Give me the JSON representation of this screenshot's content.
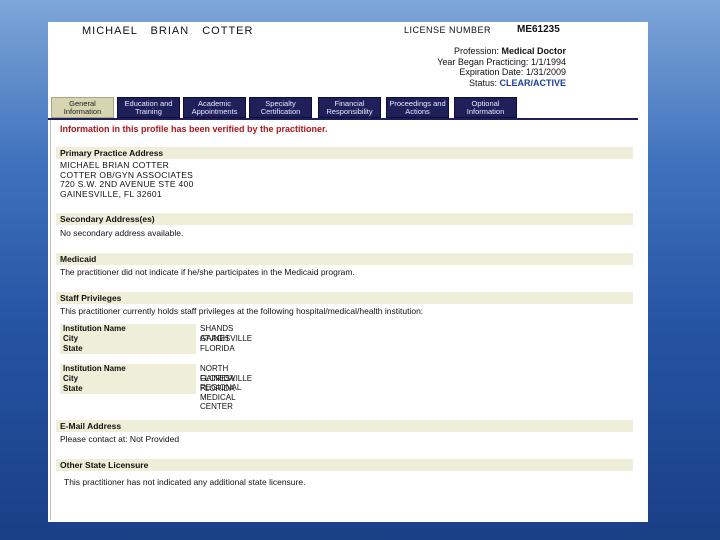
{
  "header": {
    "name": "MICHAEL BRIAN COTTER",
    "license_label": "LICENSE NUMBER",
    "license_number": "ME61235",
    "fields": [
      {
        "label": "Profession:",
        "value": "Medical Doctor"
      },
      {
        "label": "Year Began Practicing:",
        "value": "1/1/1994"
      },
      {
        "label": "Expiration Date:",
        "value": "1/31/2009"
      },
      {
        "label": "Status:",
        "value": "CLEAR/ACTIVE"
      }
    ]
  },
  "tabs": [
    {
      "label": "General Information"
    },
    {
      "label": "Education and Training"
    },
    {
      "label": "Academic Appointments"
    },
    {
      "label": "Specialty Certification"
    },
    {
      "label": "Financial Responsibility"
    },
    {
      "label": "Proceedings and Actions"
    },
    {
      "label": "Optional Information"
    }
  ],
  "verified_notice": "Information in this profile has been verified by the practitioner.",
  "primary_address": {
    "title": "Primary Practice Address",
    "lines": [
      "MICHAEL BRIAN COTTER",
      "COTTER OB/GYN ASSOCIATES",
      "720 S.W. 2ND AVENUE STE 400",
      "GAINESVILLE, FL 32601"
    ]
  },
  "secondary_address": {
    "title": "Secondary Address(es)",
    "text": "No secondary address available."
  },
  "medicaid": {
    "title": "Medicaid",
    "text": "The practitioner did not indicate if he/she participates in the Medicaid program."
  },
  "staff_privileges": {
    "title": "Staff Privileges",
    "intro": "This practitioner currently holds staff privileges at the following hospital/medical/health institution:",
    "labels": {
      "institution": "Institution Name",
      "city": "City",
      "state": "State"
    },
    "institutions": [
      {
        "name": "SHANDS AT AGH",
        "city": "GAINESVILLE",
        "state": "FLORIDA"
      },
      {
        "name": "NORTH FLORIDA REGIONAL MEDICAL CENTER",
        "city": "GAINESVILLE",
        "state": "FLORIDA"
      }
    ]
  },
  "email": {
    "title": "E-Mail Address",
    "text": "Please contact at: Not Provided"
  },
  "other_state": {
    "title": "Other State Licensure",
    "text": "This practitioner has not indicated any additional state licensure."
  }
}
